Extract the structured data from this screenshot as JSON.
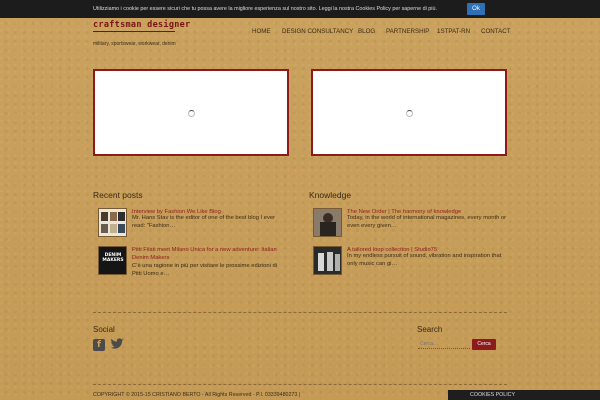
{
  "cookie_bar": {
    "text": "Utilizziamo i cookie per essere sicuri che tu possa avere la migliore esperienza sul nostro sito. Leggi la nostra Cookies Policy per saperne di più.",
    "ok_label": "Ok"
  },
  "logo": {
    "title": "craftsman designer",
    "tagline": "military, sportswear, workwear, denim"
  },
  "nav": {
    "items": [
      "HOME",
      "DESIGN CONSULTANCY",
      "BLOG",
      "PARTNERSHIP",
      "1STPAT-RN",
      "CONTACT"
    ]
  },
  "recent_posts": {
    "title": "Recent posts",
    "items": [
      {
        "title": "Interview by Fashion We Like Blog",
        "excerpt": "Mr. Hans Stav is the editor of one of the best blog I ever read: \"Fashion…"
      },
      {
        "title": "Pitti Filati meet Milano Unica for a new adventure: Italian Denim Makers",
        "excerpt": "C’è una ragione in più per visitare  le prossime edizioni di Pitti Uomo e…",
        "thumb_text": "DENIM MAKERS"
      }
    ]
  },
  "knowledge": {
    "title": "Knowledge",
    "items": [
      {
        "title": "The New Order | The harmony of knowledge",
        "excerpt": "Today, in the world of international magazines, every month or even every given…"
      },
      {
        "title": "A tailored loop collection | Studio75",
        "excerpt": "In my endless pursuit of sound, vibration and inspiration that only music can gi…"
      }
    ]
  },
  "footer": {
    "social_title": "Social",
    "search_title": "Search",
    "search_placeholder": "Cerca…",
    "search_button": "Cerca",
    "copyright": "COPYRIGHT © 2015-15 CRISTIANO BERTO - All Rights Reserved - P.I. 03339480273 |",
    "cookie_policy": "COOKIES POLICY"
  },
  "colors": {
    "background": "#c9a05c",
    "accent": "#8d1b1b",
    "cookie_button": "#2f6fb5"
  }
}
